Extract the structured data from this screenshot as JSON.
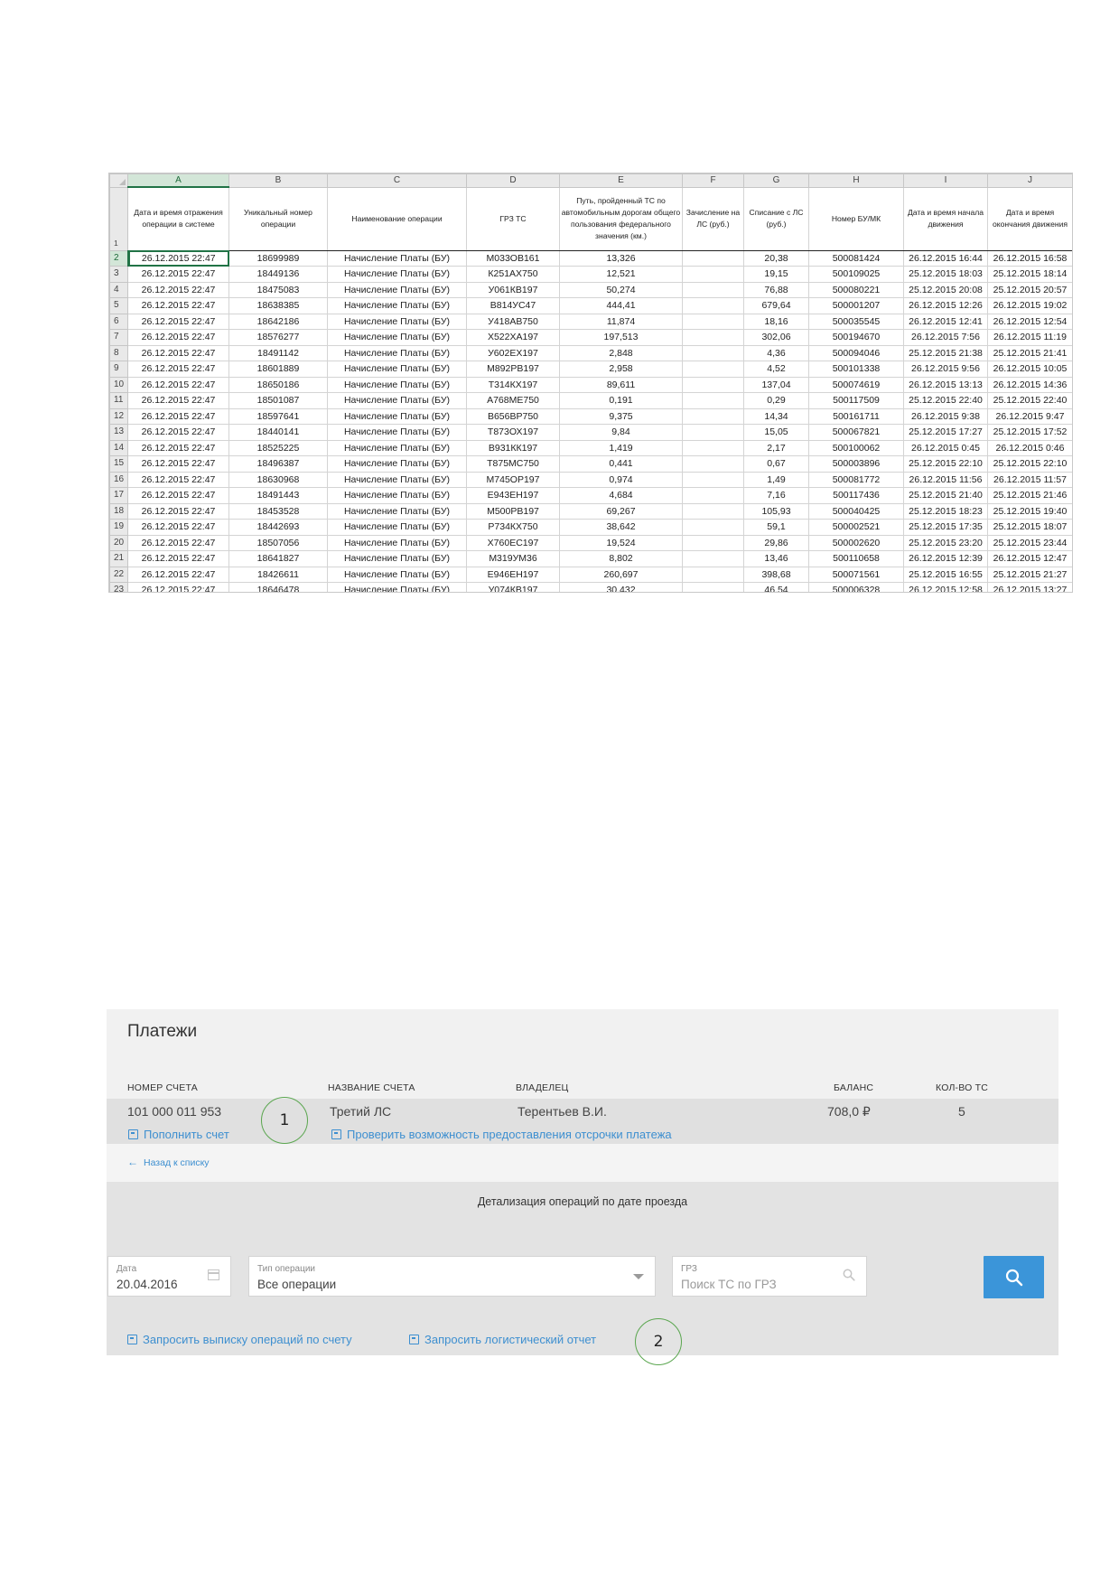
{
  "spreadsheet": {
    "column_letters": [
      "A",
      "B",
      "C",
      "D",
      "E",
      "F",
      "G",
      "H",
      "I",
      "J"
    ],
    "header_row_number": "1",
    "headers": [
      "Дата и время отражения операции в системе",
      "Уникальный номер операции",
      "Наименование операции",
      "ГРЗ ТС",
      "Путь, пройденный ТС по автомобильным дорогам общего пользования федерального значения (км.)",
      "Зачисление на ЛС (руб.)",
      "Списание с ЛС (руб.)",
      "Номер БУ/МК",
      "Дата и время начала движения",
      "Дата и время окончания движения"
    ],
    "rows": [
      {
        "n": "2",
        "cells": [
          "26.12.2015 22:47",
          "18699989",
          "Начисление Платы (БУ)",
          "М033ОВ161",
          "13,326",
          "",
          "20,38",
          "500081424",
          "26.12.2015 16:44",
          "26.12.2015 16:58"
        ]
      },
      {
        "n": "3",
        "cells": [
          "26.12.2015 22:47",
          "18449136",
          "Начисление Платы (БУ)",
          "К251АХ750",
          "12,521",
          "",
          "19,15",
          "500109025",
          "25.12.2015 18:03",
          "25.12.2015 18:14"
        ]
      },
      {
        "n": "4",
        "cells": [
          "26.12.2015 22:47",
          "18475083",
          "Начисление Платы (БУ)",
          "У061КВ197",
          "50,274",
          "",
          "76,88",
          "500080221",
          "25.12.2015 20:08",
          "25.12.2015 20:57"
        ]
      },
      {
        "n": "5",
        "cells": [
          "26.12.2015 22:47",
          "18638385",
          "Начисление Платы (БУ)",
          "В814УС47",
          "444,41",
          "",
          "679,64",
          "500001207",
          "26.12.2015 12:26",
          "26.12.2015 19:02"
        ]
      },
      {
        "n": "6",
        "cells": [
          "26.12.2015 22:47",
          "18642186",
          "Начисление Платы (БУ)",
          "У418АВ750",
          "11,874",
          "",
          "18,16",
          "500035545",
          "26.12.2015 12:41",
          "26.12.2015 12:54"
        ]
      },
      {
        "n": "7",
        "cells": [
          "26.12.2015 22:47",
          "18576277",
          "Начисление Платы (БУ)",
          "Х522ХА197",
          "197,513",
          "",
          "302,06",
          "500194670",
          "26.12.2015 7:56",
          "26.12.2015 11:19"
        ]
      },
      {
        "n": "8",
        "cells": [
          "26.12.2015 22:47",
          "18491142",
          "Начисление Платы (БУ)",
          "У602ЕХ197",
          "2,848",
          "",
          "4,36",
          "500094046",
          "25.12.2015 21:38",
          "25.12.2015 21:41"
        ]
      },
      {
        "n": "9",
        "cells": [
          "26.12.2015 22:47",
          "18601889",
          "Начисление Платы (БУ)",
          "М892РВ197",
          "2,958",
          "",
          "4,52",
          "500101338",
          "26.12.2015 9:56",
          "26.12.2015 10:05"
        ]
      },
      {
        "n": "10",
        "cells": [
          "26.12.2015 22:47",
          "18650186",
          "Начисление Платы (БУ)",
          "Т314КХ197",
          "89,611",
          "",
          "137,04",
          "500074619",
          "26.12.2015 13:13",
          "26.12.2015 14:36"
        ]
      },
      {
        "n": "11",
        "cells": [
          "26.12.2015 22:47",
          "18501087",
          "Начисление Платы (БУ)",
          "А768МЕ750",
          "0,191",
          "",
          "0,29",
          "500117509",
          "25.12.2015 22:40",
          "25.12.2015 22:40"
        ]
      },
      {
        "n": "12",
        "cells": [
          "26.12.2015 22:47",
          "18597641",
          "Начисление Платы (БУ)",
          "В656ВР750",
          "9,375",
          "",
          "14,34",
          "500161711",
          "26.12.2015 9:38",
          "26.12.2015 9:47"
        ]
      },
      {
        "n": "13",
        "cells": [
          "26.12.2015 22:47",
          "18440141",
          "Начисление Платы (БУ)",
          "Т873ОХ197",
          "9,84",
          "",
          "15,05",
          "500067821",
          "25.12.2015 17:27",
          "25.12.2015 17:52"
        ]
      },
      {
        "n": "14",
        "cells": [
          "26.12.2015 22:47",
          "18525225",
          "Начисление Платы (БУ)",
          "В931КК197",
          "1,419",
          "",
          "2,17",
          "500100062",
          "26.12.2015 0:45",
          "26.12.2015 0:46"
        ]
      },
      {
        "n": "15",
        "cells": [
          "26.12.2015 22:47",
          "18496387",
          "Начисление Платы (БУ)",
          "Т875МС750",
          "0,441",
          "",
          "0,67",
          "500003896",
          "25.12.2015 22:10",
          "25.12.2015 22:10"
        ]
      },
      {
        "n": "16",
        "cells": [
          "26.12.2015 22:47",
          "18630968",
          "Начисление Платы (БУ)",
          "М745ОР197",
          "0,974",
          "",
          "1,49",
          "500081772",
          "26.12.2015 11:56",
          "26.12.2015 11:57"
        ]
      },
      {
        "n": "17",
        "cells": [
          "26.12.2015 22:47",
          "18491443",
          "Начисление Платы (БУ)",
          "Е943ЕН197",
          "4,684",
          "",
          "7,16",
          "500117436",
          "25.12.2015 21:40",
          "25.12.2015 21:46"
        ]
      },
      {
        "n": "18",
        "cells": [
          "26.12.2015 22:47",
          "18453528",
          "Начисление Платы (БУ)",
          "М500РВ197",
          "69,267",
          "",
          "105,93",
          "500040425",
          "25.12.2015 18:23",
          "25.12.2015 19:40"
        ]
      },
      {
        "n": "19",
        "cells": [
          "26.12.2015 22:47",
          "18442693",
          "Начисление Платы (БУ)",
          "Р734КХ750",
          "38,642",
          "",
          "59,1",
          "500002521",
          "25.12.2015 17:35",
          "25.12.2015 18:07"
        ]
      },
      {
        "n": "20",
        "cells": [
          "26.12.2015 22:47",
          "18507056",
          "Начисление Платы (БУ)",
          "Х760ЕС197",
          "19,524",
          "",
          "29,86",
          "500002620",
          "25.12.2015 23:20",
          "25.12.2015 23:44"
        ]
      },
      {
        "n": "21",
        "cells": [
          "26.12.2015 22:47",
          "18641827",
          "Начисление Платы (БУ)",
          "М319УМ36",
          "8,802",
          "",
          "13,46",
          "500110658",
          "26.12.2015 12:39",
          "26.12.2015 12:47"
        ]
      },
      {
        "n": "22",
        "cells": [
          "26.12.2015 22:47",
          "18426611",
          "Начисление Платы (БУ)",
          "Е946ЕН197",
          "260,697",
          "",
          "398,68",
          "500071561",
          "25.12.2015 16:55",
          "25.12.2015 21:27"
        ]
      },
      {
        "n": "23",
        "cells": [
          "26.12.2015 22:47",
          "18646478",
          "Начисление Платы (БУ)",
          "У074КВ197",
          "30,432",
          "",
          "46,54",
          "500006328",
          "26.12.2015 12:58",
          "26.12.2015 13:27"
        ]
      }
    ]
  },
  "payments": {
    "title": "Платежи",
    "columns": {
      "account_number": "НОМЕР СЧЕТА",
      "account_name": "НАЗВАНИЕ СЧЕТА",
      "owner": "ВЛАДЕЛЕЦ",
      "balance": "БАЛАНС",
      "vehicles": "КОЛ-ВО ТС"
    },
    "account": {
      "number": "101 000 011 953",
      "name": "Третий ЛС",
      "owner": "Терентьев В.И.",
      "balance": "708,0 ₽",
      "vehicles": "5"
    },
    "links": {
      "top_up": "Пополнить счет",
      "check_deferral": "Проверить возможность предоставления отсрочки платежа",
      "back": "Назад к списку",
      "request_statement": "Запросить выписку операций по счету",
      "request_logistics": "Запросить логистический отчет"
    },
    "detail_title": "Детализация операций по дате проезда",
    "filters": {
      "date_label": "Дата",
      "date_value": "20.04.2016",
      "type_label": "Тип операции",
      "type_value": "Все операции",
      "grz_label": "ГРЗ",
      "grz_placeholder": "Поиск ТС по ГРЗ"
    },
    "callouts": [
      "1",
      "2"
    ],
    "colors": {
      "link": "#3d8fd0",
      "button": "#3b95d9",
      "callout": "#5aa64f"
    }
  }
}
